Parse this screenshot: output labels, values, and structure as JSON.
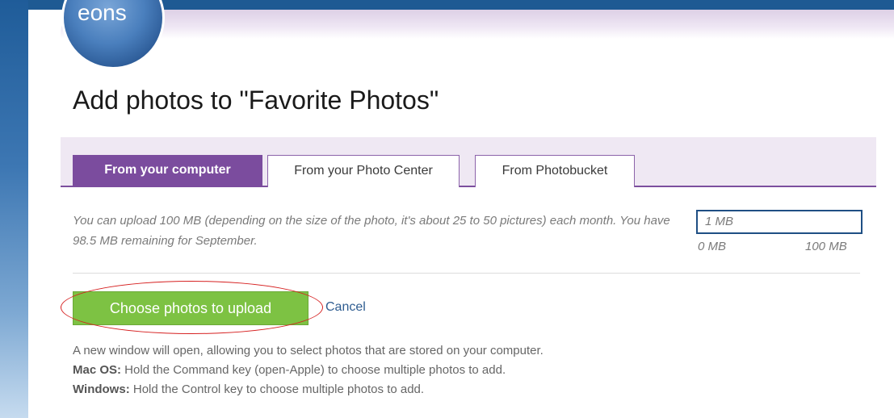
{
  "header": {
    "logo_text": "eons",
    "title": "Add photos to \"Favorite Photos\""
  },
  "tabs": [
    {
      "label": "From your computer",
      "active": true
    },
    {
      "label": "From your Photo Center",
      "active": false
    },
    {
      "label": "From Photobucket",
      "active": false
    }
  ],
  "quota": {
    "description": "You can upload 100 MB (depending on the size of the photo, it's about 25 to 50 pictures) each month. You have 98.5 MB remaining for September.",
    "used_label": "1 MB",
    "min_label": "0 MB",
    "max_label": "100 MB"
  },
  "actions": {
    "upload_label": "Choose photos to upload",
    "cancel_label": "Cancel"
  },
  "help": {
    "line1": "A new window will open, allowing you to select photos that are stored on your computer.",
    "mac_label": "Mac OS:",
    "mac_text": " Hold the Command key (open-Apple) to choose multiple photos to add.",
    "win_label": "Windows:",
    "win_text": " Hold the Control key to choose multiple photos to add."
  },
  "colors": {
    "accent_purple": "#7b4c9e",
    "button_green": "#7dc243",
    "annotation_red": "#d62020",
    "link_blue": "#2f5d91"
  }
}
